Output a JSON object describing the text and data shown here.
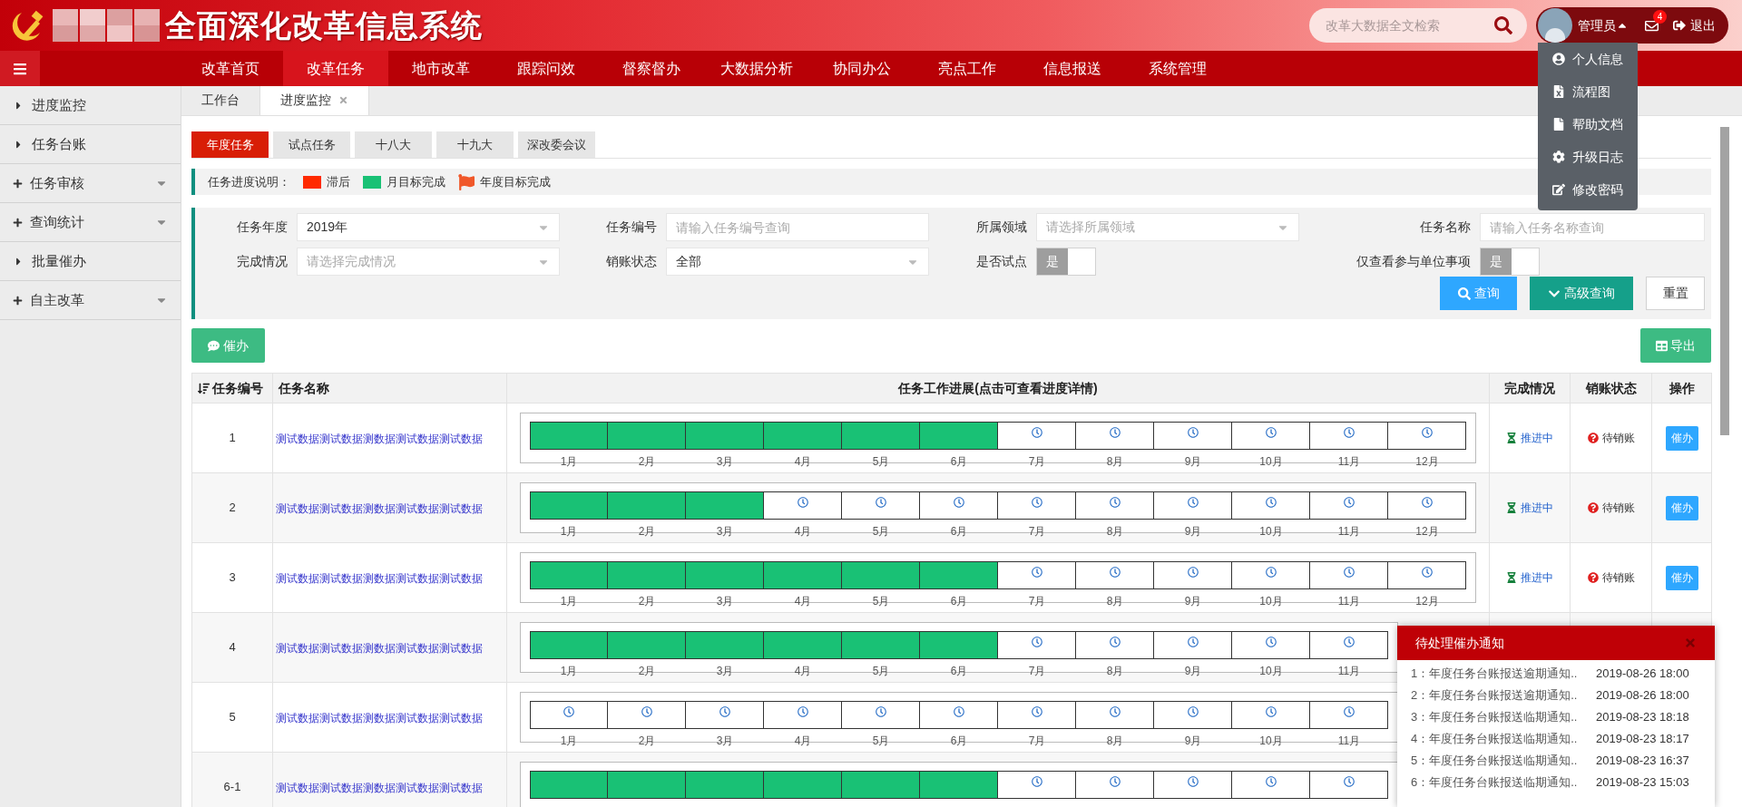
{
  "header": {
    "title": "全面深化改革信息系统",
    "search": {
      "placeholder": "改革大数据全文检索"
    }
  },
  "user": {
    "name": "管理员",
    "expanded": true,
    "mail_count": "4",
    "logout": "退出"
  },
  "user_menu": [
    {
      "label": "个人信息"
    },
    {
      "label": "流程图"
    },
    {
      "label": "帮助文档"
    },
    {
      "label": "升级日志"
    },
    {
      "label": "修改密码"
    }
  ],
  "nav": [
    {
      "label": "改革首页",
      "selected": false
    },
    {
      "label": "改革任务",
      "selected": true
    },
    {
      "label": "地市改革",
      "selected": false
    },
    {
      "label": "跟踪问效",
      "selected": false
    },
    {
      "label": "督察督办",
      "selected": false
    },
    {
      "label": "大数据分析",
      "selected": false
    },
    {
      "label": "协同办公",
      "selected": false
    },
    {
      "label": "亮点工作",
      "selected": false
    },
    {
      "label": "信息报送",
      "selected": false
    },
    {
      "label": "系统管理",
      "selected": false
    }
  ],
  "sidebar": [
    {
      "label": "进度监控",
      "kind": "leaf"
    },
    {
      "label": "任务台账",
      "kind": "leaf"
    },
    {
      "label": "任务审核",
      "kind": "group"
    },
    {
      "label": "查询统计",
      "kind": "group"
    },
    {
      "label": "批量催办",
      "kind": "leaf"
    },
    {
      "label": "自主改革",
      "kind": "group"
    }
  ],
  "page_tabs": [
    {
      "label": "工作台",
      "selected": false
    },
    {
      "label": "进度监控",
      "selected": true
    }
  ],
  "sub_tabs": [
    {
      "label": "年度任务",
      "selected": true
    },
    {
      "label": "试点任务",
      "selected": false
    },
    {
      "label": "十八大",
      "selected": false
    },
    {
      "label": "十九大",
      "selected": false
    },
    {
      "label": "深改委会议",
      "selected": false
    }
  ],
  "legend": {
    "title": "任务进度说明：",
    "items": [
      {
        "label": "滞后",
        "kind": "swatch",
        "color": "#ff2a00"
      },
      {
        "label": "月目标完成",
        "kind": "swatch",
        "color": "#19c175"
      },
      {
        "label": "年度目标完成",
        "kind": "flag",
        "color": "#f0582a"
      }
    ]
  },
  "filters": [
    {
      "label": "任务年度",
      "kind": "select",
      "value": "2019年"
    },
    {
      "label": "任务编号",
      "kind": "text",
      "placeholder": "请输入任务编号查询"
    },
    {
      "label": "所属领域",
      "kind": "select",
      "placeholder": "请选择所属领域"
    },
    {
      "label": "任务名称",
      "kind": "text",
      "placeholder": "请输入任务名称查询"
    },
    {
      "label": "完成情况",
      "kind": "select",
      "placeholder": "请选择完成情况"
    },
    {
      "label": "销账状态",
      "kind": "select",
      "value": "全部"
    },
    {
      "label": "是否试点",
      "kind": "toggle",
      "toggle_label": "是",
      "on": false
    },
    {
      "label": "仅查看参与单位事项",
      "kind": "toggle",
      "toggle_label": "是",
      "on": false
    }
  ],
  "filter_buttons": [
    {
      "label": "查询",
      "kind": "search"
    },
    {
      "label": "高级查询",
      "kind": "advanced"
    },
    {
      "label": "重置",
      "kind": "reset"
    }
  ],
  "toolbar": {
    "urge": "催办",
    "export": "导出"
  },
  "table": {
    "columns": [
      "任务编号",
      "任务名称",
      "任务工作进展(点击可查看进度详情)",
      "完成情况",
      "销账状态",
      "操作"
    ],
    "rows": [
      {
        "number": "1",
        "name": "测试数据测试数据测数据测试数据测试数据",
        "completion": "推进中",
        "writeoff": "待销账",
        "action": "催办",
        "progress": [
          {
            "month": "1月",
            "done": true
          },
          {
            "month": "2月",
            "done": true
          },
          {
            "month": "3月",
            "done": true
          },
          {
            "month": "4月",
            "done": true
          },
          {
            "month": "5月",
            "done": true
          },
          {
            "month": "6月",
            "done": true
          },
          {
            "month": "7月",
            "done": false
          },
          {
            "month": "8月",
            "done": false
          },
          {
            "month": "9月",
            "done": false
          },
          {
            "month": "10月",
            "done": false
          },
          {
            "month": "11月",
            "done": false
          },
          {
            "month": "12月",
            "done": false
          }
        ]
      },
      {
        "number": "2",
        "name": "测试数据测试数据测数据测试数据测试数据",
        "completion": "推进中",
        "writeoff": "待销账",
        "action": "催办",
        "progress": [
          {
            "month": "1月",
            "done": true
          },
          {
            "month": "2月",
            "done": true
          },
          {
            "month": "3月",
            "done": true
          },
          {
            "month": "4月",
            "done": false
          },
          {
            "month": "5月",
            "done": false
          },
          {
            "month": "6月",
            "done": false
          },
          {
            "month": "7月",
            "done": false
          },
          {
            "month": "8月",
            "done": false
          },
          {
            "month": "9月",
            "done": false
          },
          {
            "month": "10月",
            "done": false
          },
          {
            "month": "11月",
            "done": false
          },
          {
            "month": "12月",
            "done": false
          }
        ]
      },
      {
        "number": "3",
        "name": "测试数据测试数据测数据测试数据测试数据",
        "completion": "推进中",
        "writeoff": "待销账",
        "action": "催办",
        "progress": [
          {
            "month": "1月",
            "done": true
          },
          {
            "month": "2月",
            "done": true
          },
          {
            "month": "3月",
            "done": true
          },
          {
            "month": "4月",
            "done": true
          },
          {
            "month": "5月",
            "done": true
          },
          {
            "month": "6月",
            "done": true
          },
          {
            "month": "7月",
            "done": false
          },
          {
            "month": "8月",
            "done": false
          },
          {
            "month": "9月",
            "done": false
          },
          {
            "month": "10月",
            "done": false
          },
          {
            "month": "11月",
            "done": false
          },
          {
            "month": "12月",
            "done": false
          }
        ]
      },
      {
        "number": "4",
        "name": "测试数据测试数据测数据测试数据测试数据",
        "progress": [
          {
            "month": "1月",
            "done": true
          },
          {
            "month": "2月",
            "done": true
          },
          {
            "month": "3月",
            "done": true
          },
          {
            "month": "4月",
            "done": true
          },
          {
            "month": "5月",
            "done": true
          },
          {
            "month": "6月",
            "done": true
          },
          {
            "month": "7月",
            "done": false
          },
          {
            "month": "8月",
            "done": false
          },
          {
            "month": "9月",
            "done": false
          },
          {
            "month": "10月",
            "done": false
          },
          {
            "month": "11月",
            "done": false
          }
        ]
      },
      {
        "number": "5",
        "name": "测试数据测试数据测数据测试数据测试数据",
        "progress": [
          {
            "month": "1月",
            "done": false
          },
          {
            "month": "2月",
            "done": false
          },
          {
            "month": "3月",
            "done": false
          },
          {
            "month": "4月",
            "done": false
          },
          {
            "month": "5月",
            "done": false
          },
          {
            "month": "6月",
            "done": false
          },
          {
            "month": "7月",
            "done": false
          },
          {
            "month": "8月",
            "done": false
          },
          {
            "month": "9月",
            "done": false
          },
          {
            "month": "10月",
            "done": false
          },
          {
            "month": "11月",
            "done": false
          }
        ]
      },
      {
        "number": "6-1",
        "name": "测试数据测试数据测数据测试数据测试数据",
        "progress": [
          {
            "done": true
          },
          {
            "done": true
          },
          {
            "done": true
          },
          {
            "done": true
          },
          {
            "done": true
          },
          {
            "done": true
          },
          {
            "done": false
          },
          {
            "done": false
          },
          {
            "done": false
          },
          {
            "done": false
          },
          {
            "done": false
          }
        ]
      }
    ]
  },
  "notice": {
    "title": "待处理催办通知",
    "items": [
      {
        "text": "1：年度任务台账报送逾期通知..",
        "time": "2019-08-26 18:00"
      },
      {
        "text": "2：年度任务台账报送逾期通知..",
        "time": "2019-08-26 18:00"
      },
      {
        "text": "3：年度任务台账报送临期通知..",
        "time": "2019-08-23 18:18"
      },
      {
        "text": "4：年度任务台账报送临期通知..",
        "time": "2019-08-23 18:17"
      },
      {
        "text": "5：年度任务台账报送临期通知..",
        "time": "2019-08-23 16:37"
      },
      {
        "text": "6：年度任务台账报送临期通知..",
        "time": "2019-08-23 15:03"
      }
    ]
  }
}
